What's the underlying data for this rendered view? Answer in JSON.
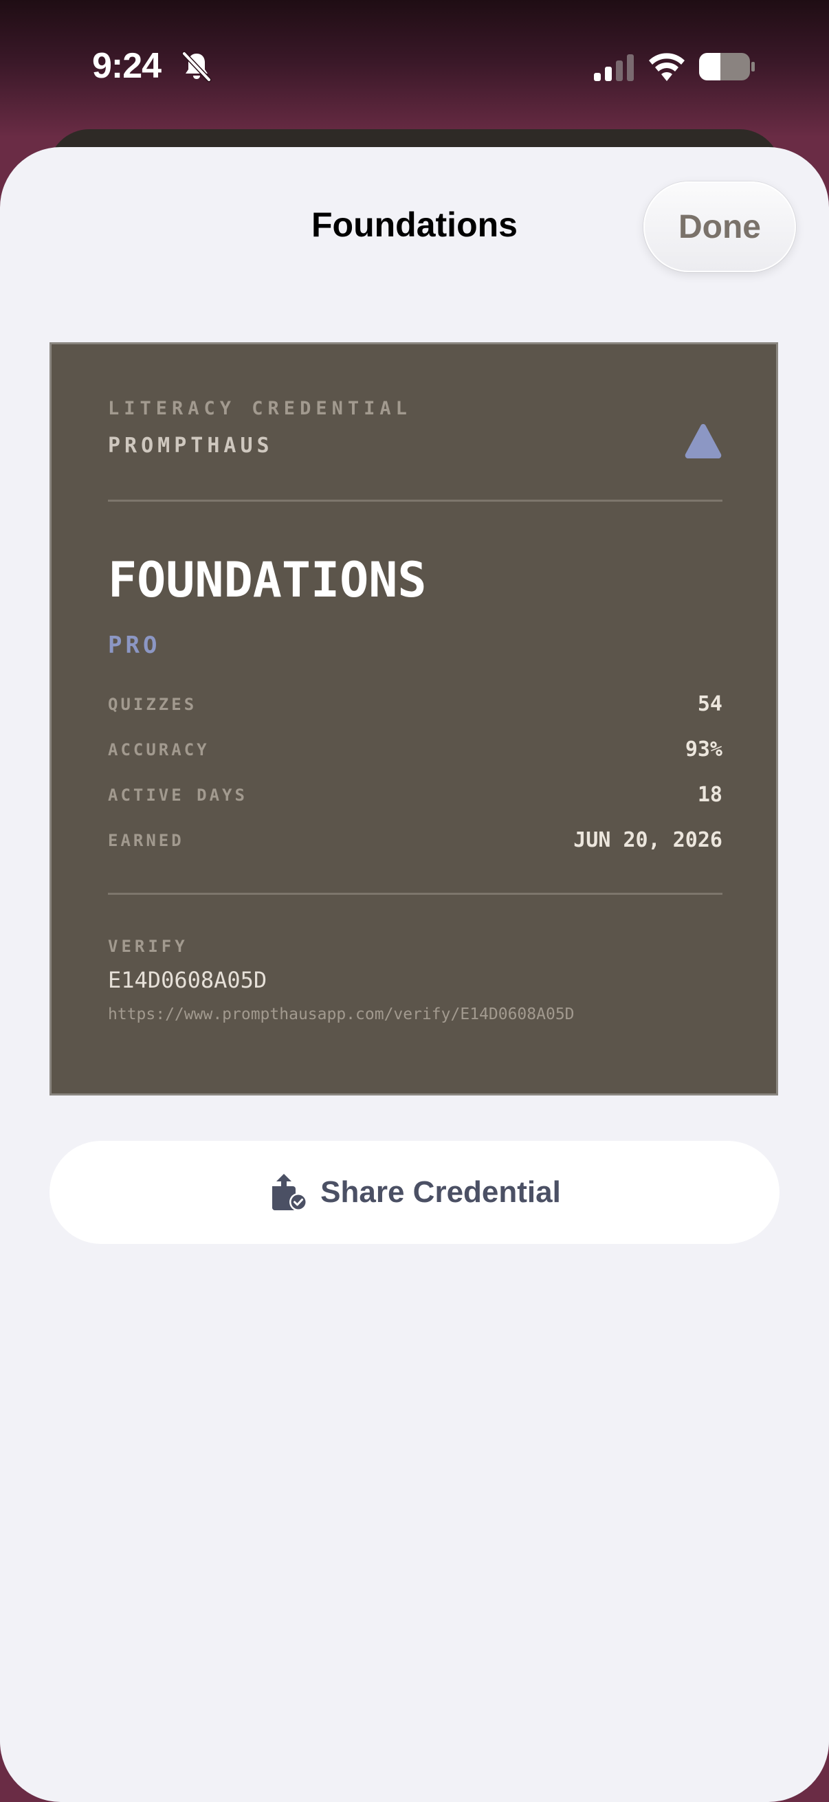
{
  "status_bar": {
    "time": "9:24",
    "silent_icon": "bell-slash-icon",
    "signal_icon": "cellular-signal-icon",
    "wifi_icon": "wifi-icon",
    "battery_icon": "battery-icon"
  },
  "sheet": {
    "title": "Foundations",
    "done_label": "Done"
  },
  "card": {
    "kicker": "LITERACY CREDENTIAL",
    "brand": "PROMPTHAUS",
    "brand_icon": "triangle-icon",
    "title": "FOUNDATIONS",
    "tier": "PRO",
    "stats": [
      {
        "label": "QUIZZES",
        "value": "54"
      },
      {
        "label": "ACCURACY",
        "value": "93%"
      },
      {
        "label": "ACTIVE DAYS",
        "value": "18"
      },
      {
        "label": "EARNED",
        "value": "JUN 20, 2026"
      }
    ],
    "verify_label": "VERIFY",
    "verify_code": "E14D0608A05D",
    "verify_url": "https://www.prompthausapp.com/verify/E14D0608A05D"
  },
  "share": {
    "label": "Share Credential",
    "icon": "share-credential-icon"
  },
  "colors": {
    "card_background": "#5c554b",
    "accent": "#8c97c4",
    "sheet_background": "#f2f2f7",
    "share_text": "#4b5064"
  }
}
